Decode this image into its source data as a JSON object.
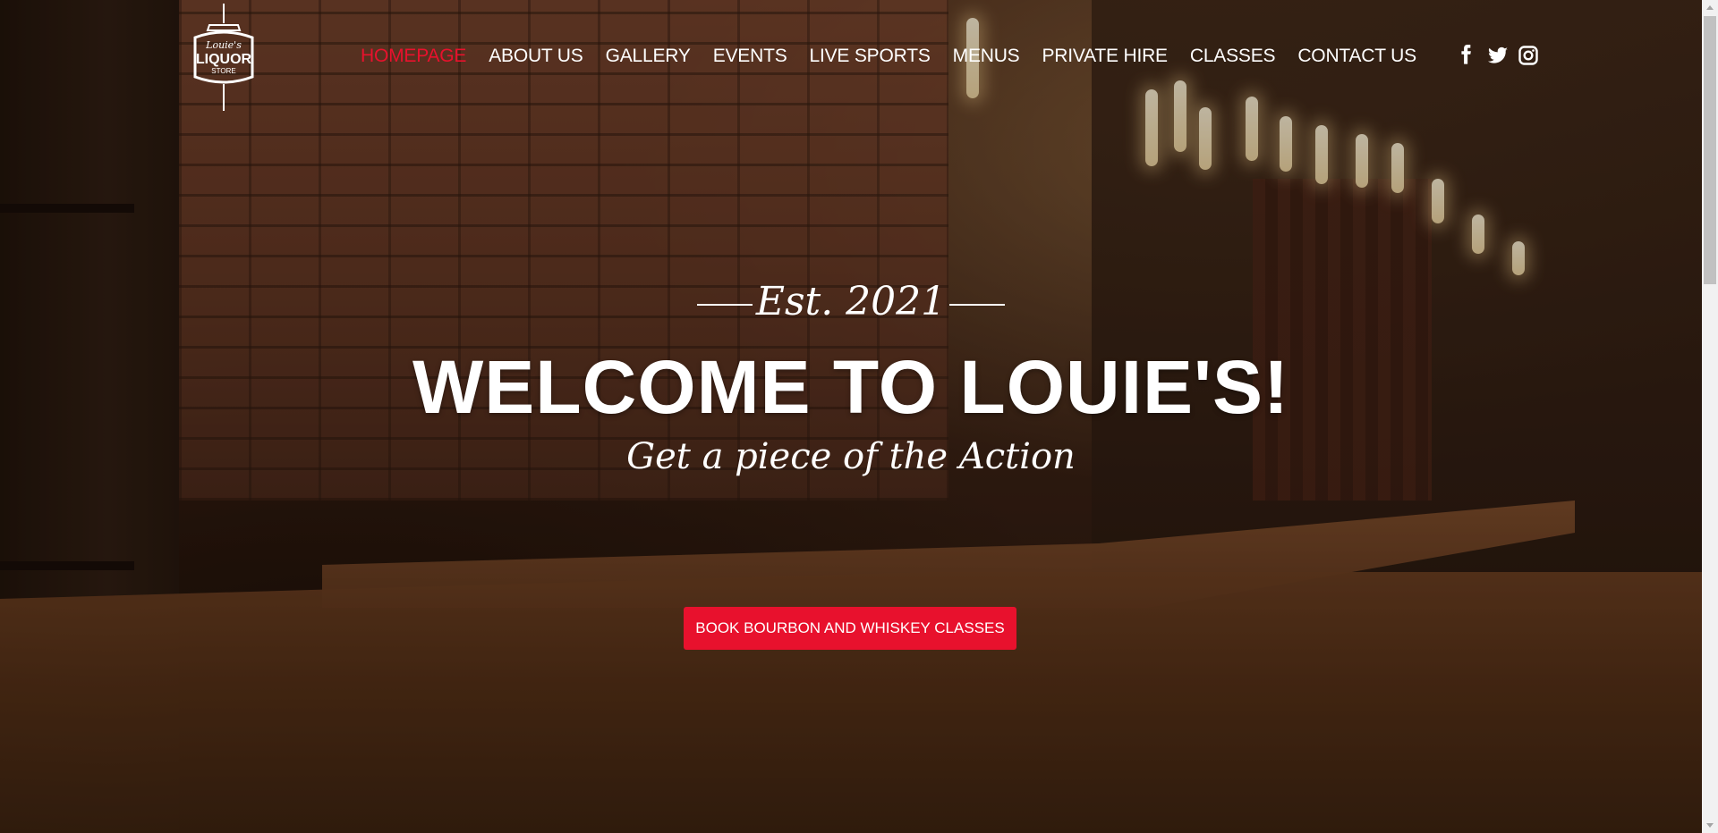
{
  "logo": {
    "text_top": "Louie's",
    "text_main": "LIQUOR",
    "text_sub": "STORE"
  },
  "nav": {
    "items": [
      {
        "label": "HOMEPAGE",
        "active": true
      },
      {
        "label": "ABOUT US"
      },
      {
        "label": "GALLERY"
      },
      {
        "label": "EVENTS"
      },
      {
        "label": "LIVE SPORTS"
      },
      {
        "label": "MENUS"
      },
      {
        "label": "PRIVATE HIRE"
      },
      {
        "label": "CLASSES"
      },
      {
        "label": "CONTACT US"
      }
    ],
    "active_color": "#e8112d"
  },
  "social": {
    "icons": [
      "facebook-icon",
      "twitter-icon",
      "instagram-icon"
    ]
  },
  "hero": {
    "est": "Est. 2021",
    "headline": "WELCOME TO LOUIE'S!",
    "tagline": "Get a piece of the Action",
    "cta_label": "BOOK BOURBON AND WHISKEY CLASSES"
  },
  "colors": {
    "accent": "#e8112d",
    "text": "#ffffff"
  }
}
